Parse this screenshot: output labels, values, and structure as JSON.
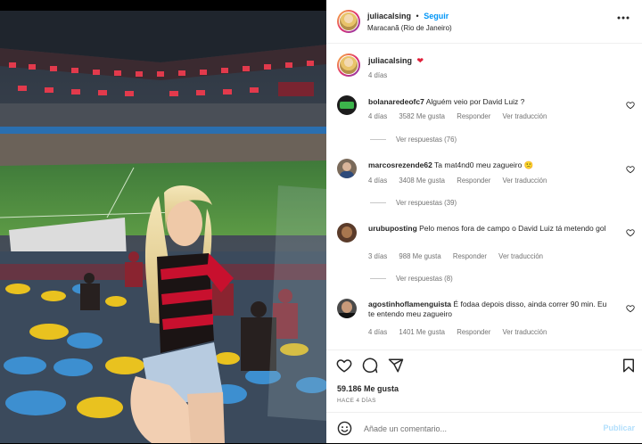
{
  "post": {
    "username": "juliacalsing",
    "separator": "•",
    "follow_label": "Seguir",
    "location": "Maracanã (Rio de Janeiro)",
    "caption_user": "juliacalsing",
    "caption_emoji": "❤",
    "caption_time": "4 días"
  },
  "comments": [
    {
      "user": "bolanaredeofc7",
      "text": "Alguém veio por David Luiz ?",
      "time": "4 días",
      "likes": "3582 Me gusta",
      "reply": "Responder",
      "translate": "Ver traducción",
      "replies": "Ver respuestas (76)"
    },
    {
      "user": "marcosrezende62",
      "text": "Ta mat4nd0 meu zagueiro 🙁",
      "time": "4 días",
      "likes": "3408 Me gusta",
      "reply": "Responder",
      "translate": "Ver traducción",
      "replies": "Ver respuestas (39)"
    },
    {
      "user": "urubuposting",
      "text": "Pelo menos fora de campo o David Luiz tá metendo gol",
      "time": "3 días",
      "likes": "988 Me gusta",
      "reply": "Responder",
      "translate": "Ver traducción",
      "replies": "Ver respuestas (8)"
    },
    {
      "user": "agostinhoflamenguista",
      "text": "É fodaa depois disso, ainda correr 90 min. Eu te entendo meu zagueiro",
      "time": "4 días",
      "likes": "1401 Me gusta",
      "reply": "Responder",
      "translate": "Ver traducción"
    }
  ],
  "stats": {
    "likes": "59.186 Me gusta",
    "posted": "HACE 4 DÍAS"
  },
  "composer": {
    "placeholder": "Añade un comentario...",
    "publish_label": "Publicar"
  },
  "icons": [
    "more-options-icon",
    "heart-icon",
    "comment-icon",
    "share-icon",
    "bookmark-icon",
    "emoji-icon"
  ],
  "colors": {
    "accent": "#0095f6",
    "like_red": "#ed4956",
    "muted": "#737373",
    "publish_disabled": "#b2dffc"
  }
}
